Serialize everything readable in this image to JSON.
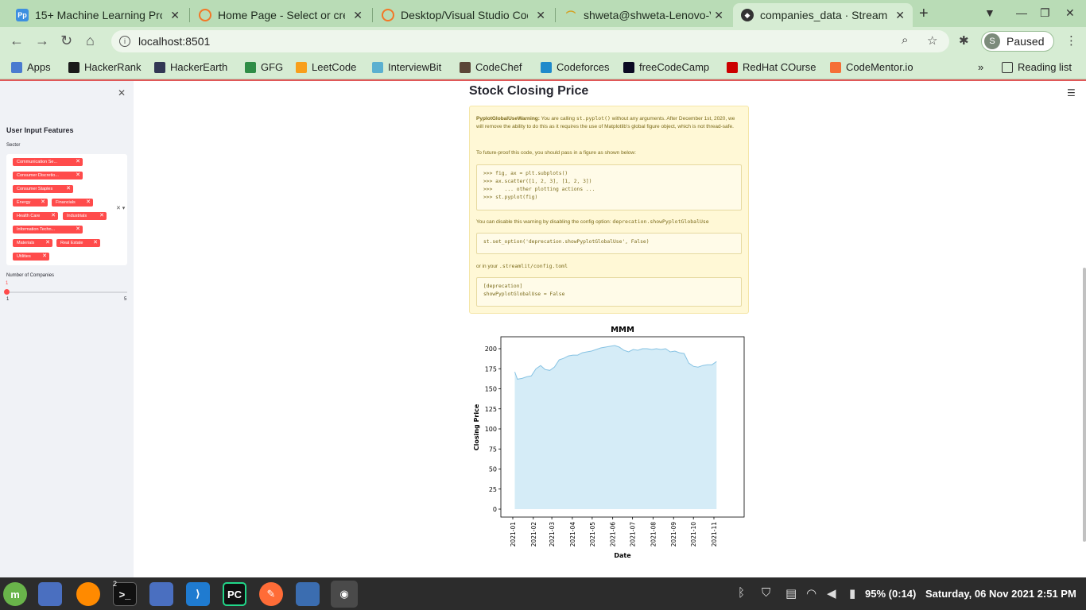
{
  "browser": {
    "tabs": [
      {
        "title": "15+ Machine Learning Proje",
        "icon": "pp-icon",
        "color": "#3d8fe0",
        "glyph": "Pp"
      },
      {
        "title": "Home Page - Select or creat",
        "icon": "jupyter-icon",
        "color": "#f37726",
        "glyph": ""
      },
      {
        "title": "Desktop/Visual Studio Code",
        "icon": "jupyter-icon",
        "color": "#f37726",
        "glyph": ""
      },
      {
        "title": "shweta@shweta-Lenovo-V1",
        "icon": "terminal-icon",
        "color": "#d4a020",
        "glyph": ""
      },
      {
        "title": "companies_data · Streamlit",
        "icon": "streamlit-icon",
        "color": "#333333",
        "glyph": ""
      }
    ],
    "url": "localhost:8501",
    "profile_initial": "S",
    "profile_status": "Paused",
    "bookmarks": [
      {
        "label": "Apps",
        "color": "#4a7bd0"
      },
      {
        "label": "HackerRank",
        "color": "#1a1a1a"
      },
      {
        "label": "HackerEarth",
        "color": "#323754"
      },
      {
        "label": "GFG",
        "color": "#2f8d46"
      },
      {
        "label": "LeetCode",
        "color": "#f89f1b"
      },
      {
        "label": "InterviewBit",
        "color": "#5bb0d0"
      },
      {
        "label": "CodeChef",
        "color": "#5b4638"
      },
      {
        "label": "Codeforces",
        "color": "#1f8acb"
      },
      {
        "label": "freeCodeCamp",
        "color": "#0a0a23"
      },
      {
        "label": "RedHat COurse",
        "color": "#cc0000"
      },
      {
        "label": "CodeMentor.io",
        "color": "#f56f36"
      }
    ],
    "more_bookmarks": "»",
    "reading_list": "Reading list"
  },
  "sidebar": {
    "title": "User Input Features",
    "sector_label": "Sector",
    "sectors": [
      "Communication Se...",
      "Consumer Discretio...",
      "Consumer Staples",
      "Energy",
      "Financials",
      "Health Care",
      "Industrials",
      "Information Techn...",
      "Materials",
      "Real Estate",
      "Utilities"
    ],
    "companies_label": "Number of Companies",
    "slider_value": "1",
    "slider_min": "1",
    "slider_max": "5"
  },
  "main": {
    "title": "Stock Closing Price",
    "warning": {
      "heading": "PyplotGlobalUseWarning:",
      "text1a": " You are calling ",
      "code1": "st.pyplot()",
      "text1b": " without any arguments. After December 1st, 2020, we will remove the ability to do this as it requires the use of Matplotlib's global figure object, which is not thread-safe.",
      "text2": "To future-proof this code, you should pass in a figure as shown below:",
      "code_block1": ">>> fig, ax = plt.subplots()\n>>> ax.scatter([1, 2, 3], [1, 2, 3])\n>>>    ... other plotting actions ...\n>>> st.pyplot(fig)",
      "text3a": "You can disable this warning by disabling the config option: ",
      "code3": "deprecation.showPyplotGlobalUse",
      "code_block2": "st.set_option('deprecation.showPyplotGlobalUse', False)",
      "text4a": "or in your ",
      "code4": ".streamlit/config.toml",
      "code_block3": "[deprecation]\nshowPyplotGlobalUse = False"
    }
  },
  "chart_data": {
    "type": "area",
    "title": "MMM",
    "xlabel": "Date",
    "ylabel": "Closing Price",
    "ylim": [
      0,
      210
    ],
    "yticks": [
      0,
      25,
      50,
      75,
      100,
      125,
      150,
      175,
      200
    ],
    "xticks": [
      "2021-01",
      "2021-02",
      "2021-03",
      "2021-04",
      "2021-05",
      "2021-06",
      "2021-07",
      "2021-08",
      "2021-09",
      "2021-10",
      "2021-11"
    ],
    "fill_color": "#d5ecf7",
    "line_color": "#87c3e3",
    "series": [
      {
        "x": [
          "2021-01-04",
          "2021-01-08",
          "2021-01-15",
          "2021-01-22",
          "2021-01-29",
          "2021-02-05",
          "2021-02-12",
          "2021-02-19",
          "2021-02-26",
          "2021-03-05",
          "2021-03-12",
          "2021-03-19",
          "2021-03-26",
          "2021-04-02",
          "2021-04-09",
          "2021-04-16",
          "2021-04-23",
          "2021-04-30",
          "2021-05-07",
          "2021-05-14",
          "2021-05-21",
          "2021-05-28",
          "2021-06-04",
          "2021-06-11",
          "2021-06-18",
          "2021-06-25",
          "2021-07-02",
          "2021-07-09",
          "2021-07-16",
          "2021-07-23",
          "2021-07-30",
          "2021-08-06",
          "2021-08-13",
          "2021-08-20",
          "2021-08-27",
          "2021-09-03",
          "2021-09-10",
          "2021-09-17",
          "2021-09-24",
          "2021-10-01",
          "2021-10-08",
          "2021-10-15",
          "2021-10-22",
          "2021-10-29",
          "2021-11-05"
        ],
        "values": [
          171,
          162,
          163,
          165,
          166,
          175,
          179,
          174,
          173,
          177,
          186,
          188,
          191,
          192,
          192,
          195,
          196,
          197,
          199,
          201,
          202,
          203,
          204,
          202,
          198,
          196,
          199,
          198,
          200,
          200,
          199,
          200,
          199,
          200,
          196,
          197,
          195,
          194,
          182,
          178,
          177,
          179,
          180,
          180,
          184
        ]
      }
    ]
  },
  "taskbar": {
    "apps": [
      {
        "name": "mint-menu-icon",
        "color": "#69b44a",
        "glyph": "m"
      },
      {
        "name": "files-icon",
        "color": "#4a6fc0",
        "glyph": ""
      },
      {
        "name": "firefox-icon",
        "color": "#ff8a00",
        "glyph": ""
      },
      {
        "name": "terminal-icon",
        "color": "#111111",
        "glyph": ">_"
      },
      {
        "name": "folder-icon",
        "color": "#4a6fc0",
        "glyph": ""
      },
      {
        "name": "vscode-icon",
        "color": "#1f7bd0",
        "glyph": ""
      },
      {
        "name": "pycharm-icon",
        "color": "#111111",
        "glyph": "PC"
      },
      {
        "name": "postman-icon",
        "color": "#ff6c37",
        "glyph": ""
      },
      {
        "name": "virtualbox-icon",
        "color": "#3b6db0",
        "glyph": ""
      },
      {
        "name": "chrome-icon",
        "color": "#3f6f3f",
        "glyph": ""
      }
    ],
    "terminal_badge": "2",
    "battery": "95% (0:14)",
    "clock": "Saturday, 06 Nov 2021  2:51 PM"
  }
}
